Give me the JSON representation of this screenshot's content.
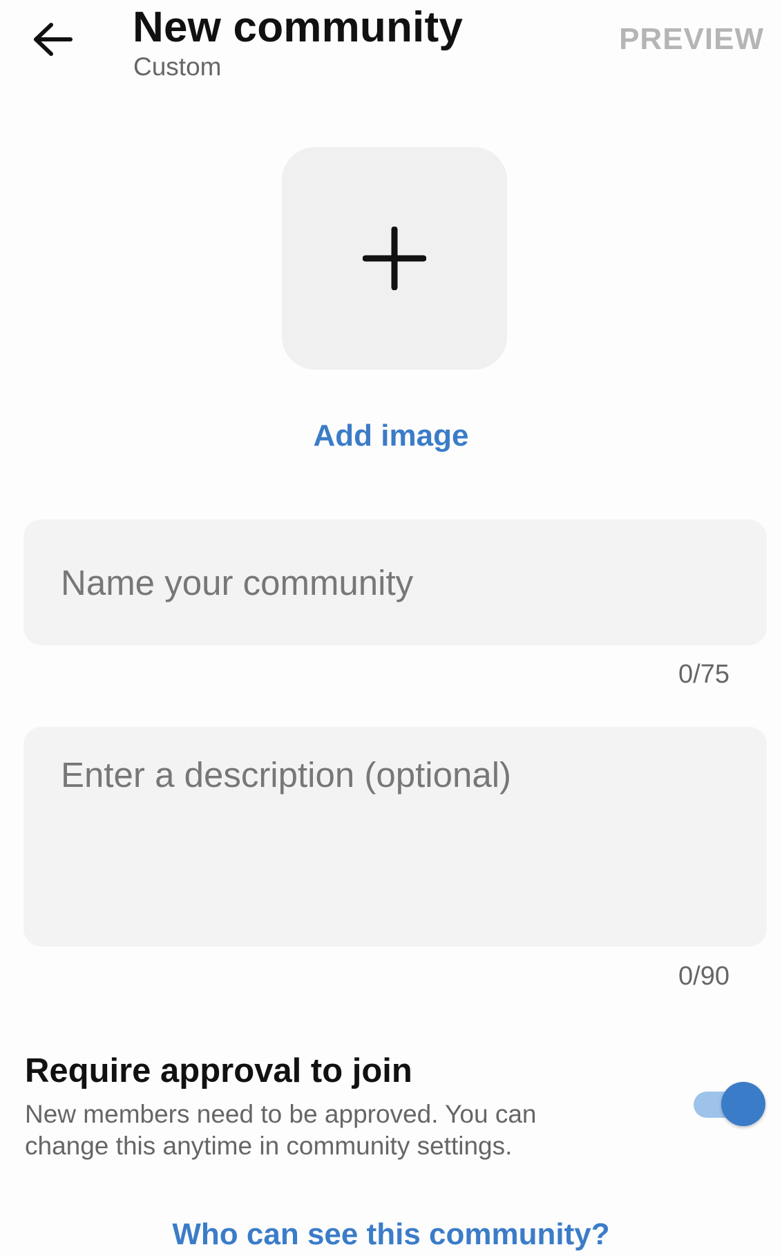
{
  "header": {
    "back_icon": "arrow-left-icon",
    "title": "New community",
    "subtitle": "Custom",
    "preview_label": "PREVIEW"
  },
  "image_picker": {
    "icon": "plus-icon",
    "label": "Add image"
  },
  "name_field": {
    "placeholder": "Name your community",
    "value": "",
    "counter": "0/75"
  },
  "description_field": {
    "placeholder": "Enter a description (optional)",
    "value": "",
    "counter": "0/90"
  },
  "approval": {
    "title": "Require approval to join",
    "description": "New members need to be approved. You can change this anytime in community settings.",
    "enabled": true
  },
  "visibility_link": "Who can see this community?",
  "colors": {
    "accent": "#3b7cc8",
    "accent_light": "#9ec3ea",
    "field_background": "#f3f3f3",
    "muted_text": "#666666"
  }
}
